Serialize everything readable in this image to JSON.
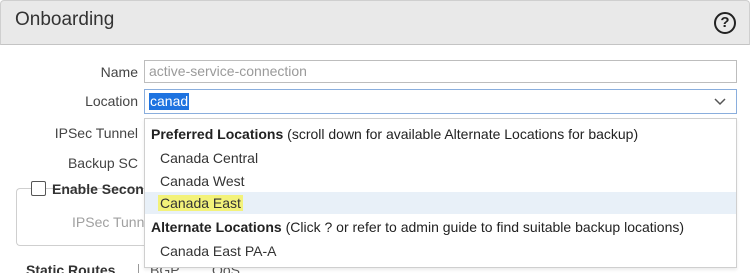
{
  "dialog": {
    "title": "Onboarding",
    "help_icon": "help-icon",
    "help_glyph": "?"
  },
  "form": {
    "name_label": "Name",
    "name_value": "active-service-connection",
    "location_label": "Location",
    "location_value": "canad",
    "ipsec_tunnel_label": "IPSec Tunnel",
    "backup_sc_label": "Backup SC",
    "enable_secondary_label": "Enable Seconda",
    "ipsec_tunnel_secondary_label": "IPSec Tunne"
  },
  "dropdown": {
    "preferred_header_bold": "Preferred Locations",
    "preferred_header_note": " (scroll down for available Alternate Locations for backup)",
    "preferred_options": [
      "Canada Central",
      "Canada West",
      "Canada East"
    ],
    "highlighted_option": "Canada East",
    "alternate_header_bold": "Alternate Locations",
    "alternate_header_note": " (Click ? or refer to admin guide to find suitable backup locations)",
    "alternate_options": [
      "Canada East PA-A"
    ]
  },
  "tabs": [
    "Static Routes",
    "BGP",
    "QoS"
  ],
  "colors": {
    "selection": "#1e73e0",
    "hover_row": "#e8f0f8",
    "match_highlight": "#f3f27a"
  }
}
